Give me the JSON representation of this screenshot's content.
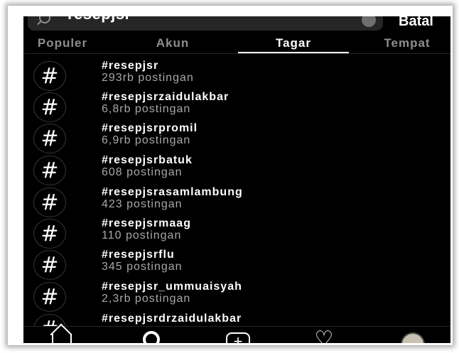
{
  "search": {
    "query": "resepjsr",
    "cancel_label": "Batal"
  },
  "tabs": [
    {
      "label": "Populer",
      "active": false
    },
    {
      "label": "Akun",
      "active": false
    },
    {
      "label": "Tagar",
      "active": true
    },
    {
      "label": "Tempat",
      "active": false
    }
  ],
  "results": [
    {
      "icon": "#",
      "name": "#resepjsr",
      "count": "293rb postingan"
    },
    {
      "icon": "#",
      "name": "#resepjsrzaidulakbar",
      "count": "6,8rb postingan"
    },
    {
      "icon": "#",
      "name": "#resepjsrpromil",
      "count": "6,9rb postingan"
    },
    {
      "icon": "#",
      "name": "#resepjsrbatuk",
      "count": "608 postingan"
    },
    {
      "icon": "#",
      "name": "#resepjsrasamlambung",
      "count": "423 postingan"
    },
    {
      "icon": "#",
      "name": "#resepjsrmaag",
      "count": "110 postingan"
    },
    {
      "icon": "#",
      "name": "#resepjsrflu",
      "count": "345 postingan"
    },
    {
      "icon": "#",
      "name": "#resepjsr_ummuaisyah",
      "count": "2,3rb postingan"
    },
    {
      "icon": "#",
      "name": "#resepjsrdrzaidulakbar",
      "count": ""
    }
  ],
  "bottom_nav": {
    "items": [
      "home-icon",
      "search-icon",
      "add-post-icon",
      "heart-icon",
      "profile-avatar"
    ],
    "plus_glyph": "+",
    "heart_glyph": "♡"
  },
  "colors": {
    "background": "#000000",
    "text_primary": "#ffffff",
    "text_secondary": "#a8a8a8",
    "tab_inactive": "#8e8e8e"
  }
}
